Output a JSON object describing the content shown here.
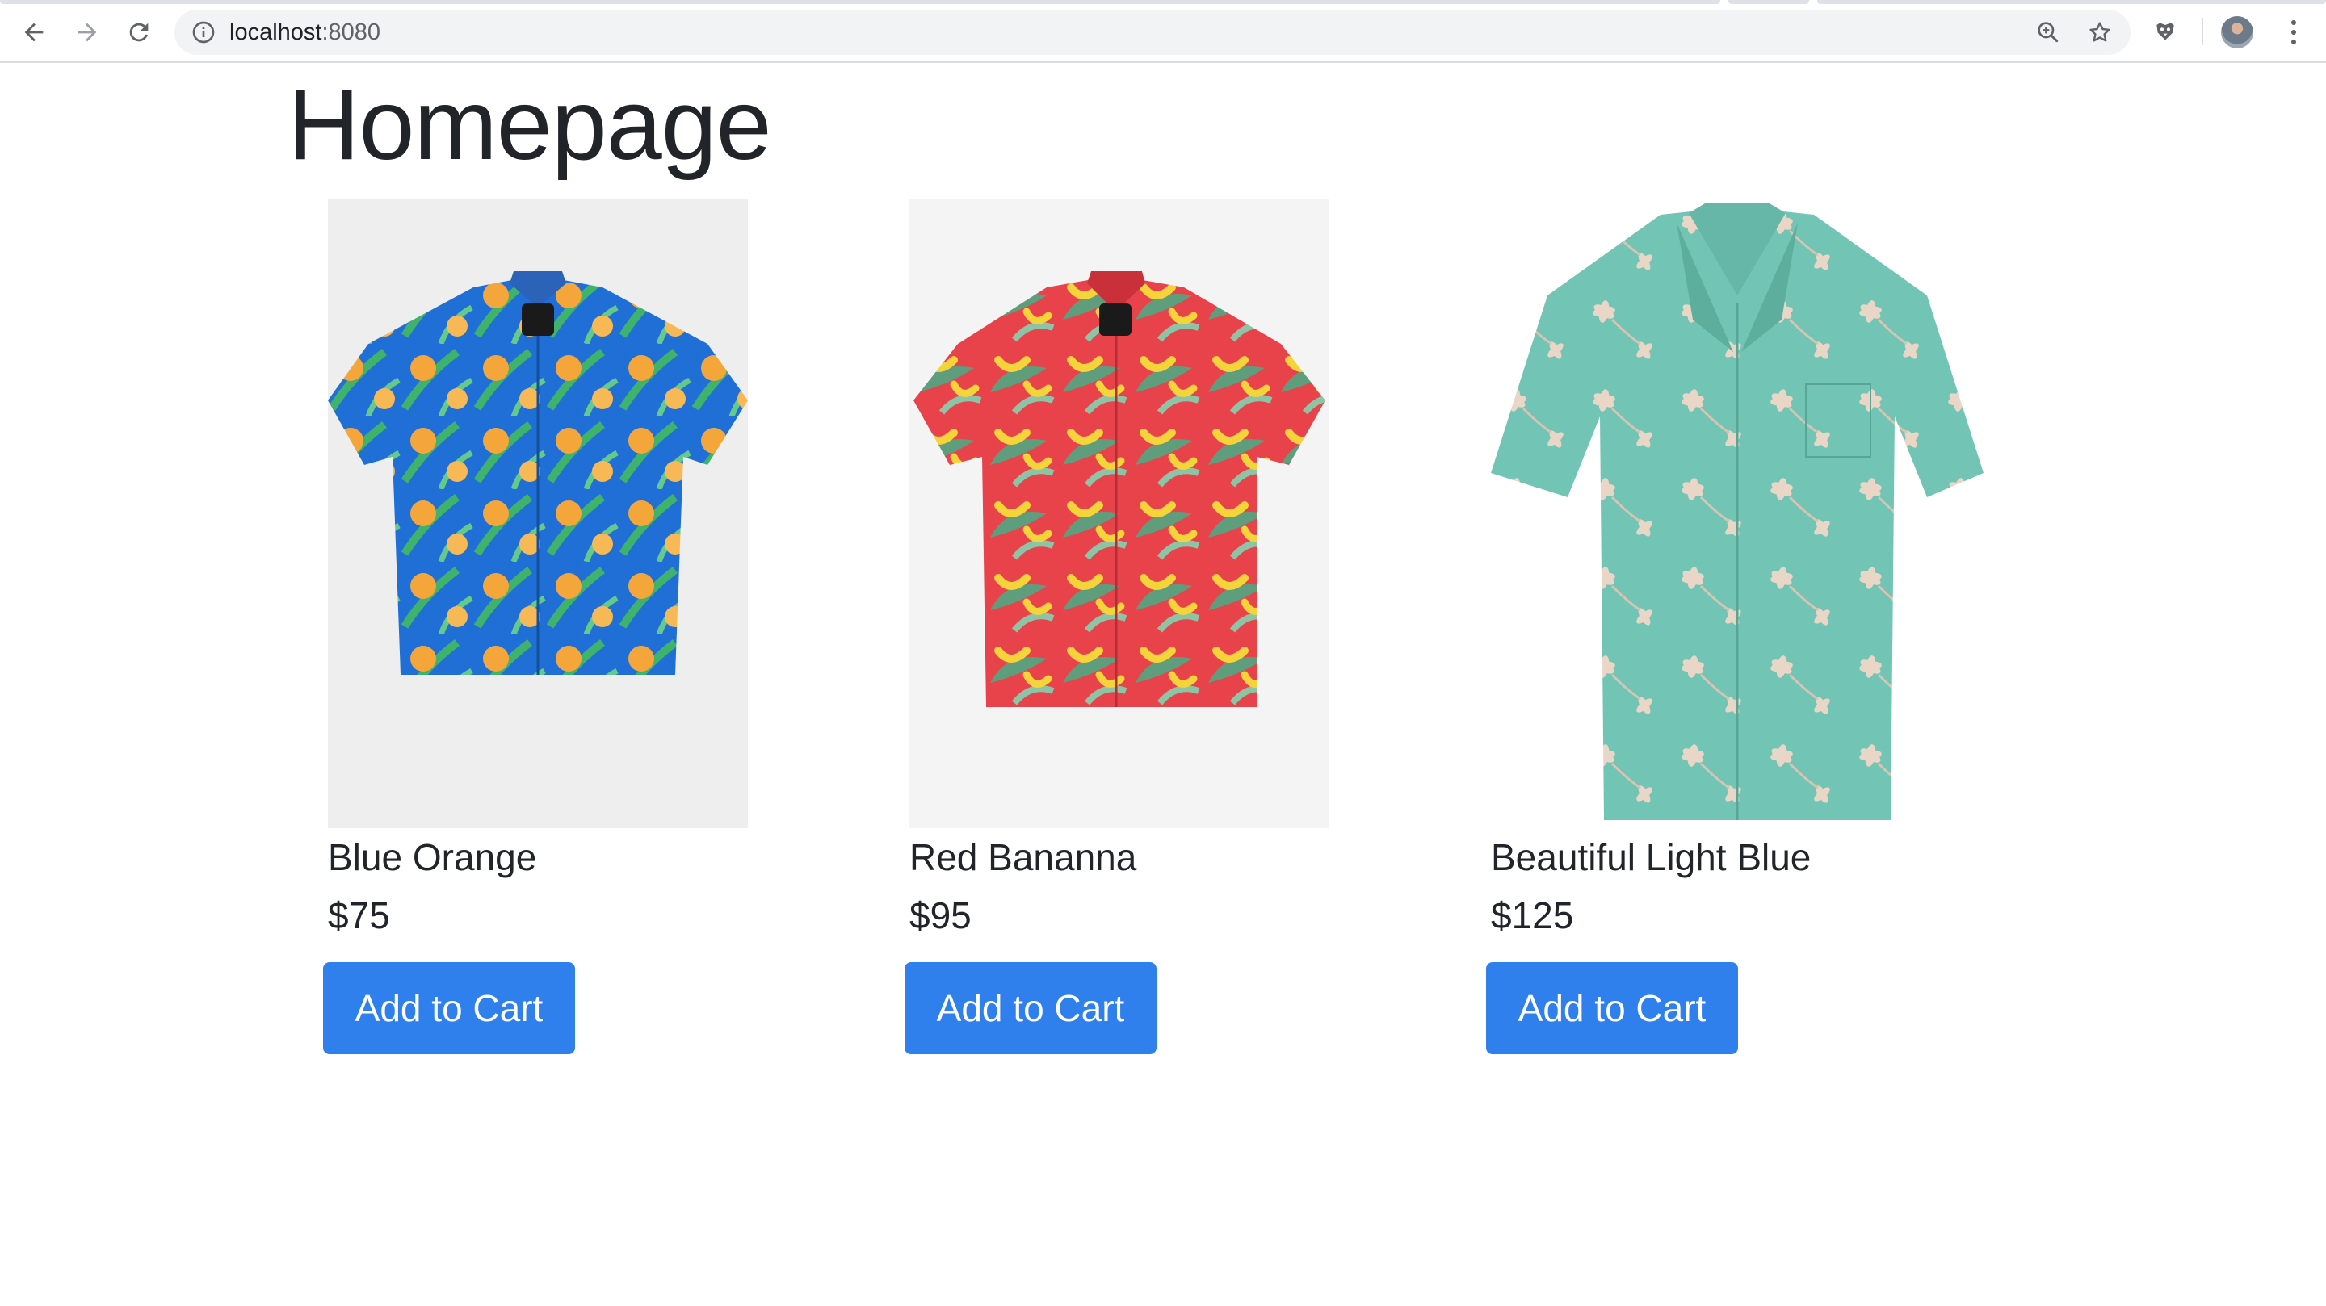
{
  "browser": {
    "url_host": "localhost",
    "url_port": ":8080",
    "icons": {
      "back": "arrow-left-icon",
      "forward": "arrow-right-icon",
      "reload": "reload-icon",
      "info": "info-icon",
      "zoom": "zoom-in-icon",
      "bookmark": "star-icon",
      "extension": "extension-icon",
      "profile": "avatar",
      "menu": "kebab-menu-icon"
    }
  },
  "page": {
    "title": "Homepage"
  },
  "products": [
    {
      "name": "Blue Orange",
      "price": "$75",
      "button_label": "Add to Cart",
      "image": "blue-orange-shirt",
      "colors": {
        "base": "#1f6fd6",
        "leaf": "#3fb36b",
        "fruit": "#f4a63a"
      }
    },
    {
      "name": "Red Bananna",
      "price": "$95",
      "button_label": "Add to Cart",
      "image": "red-banana-shirt",
      "colors": {
        "base": "#e8434b",
        "leaf": "#5f9e7c",
        "fruit": "#f5d33b"
      }
    },
    {
      "name": "Beautiful Light Blue",
      "price": "$125",
      "button_label": "Add to Cart",
      "image": "light-blue-floral-shirt",
      "colors": {
        "base": "#72c4b4",
        "leaf": "#e9d6c6",
        "fruit": "#f2e6da"
      }
    }
  ],
  "theme": {
    "button_color": "#2f80ed",
    "text_color": "#212529"
  }
}
